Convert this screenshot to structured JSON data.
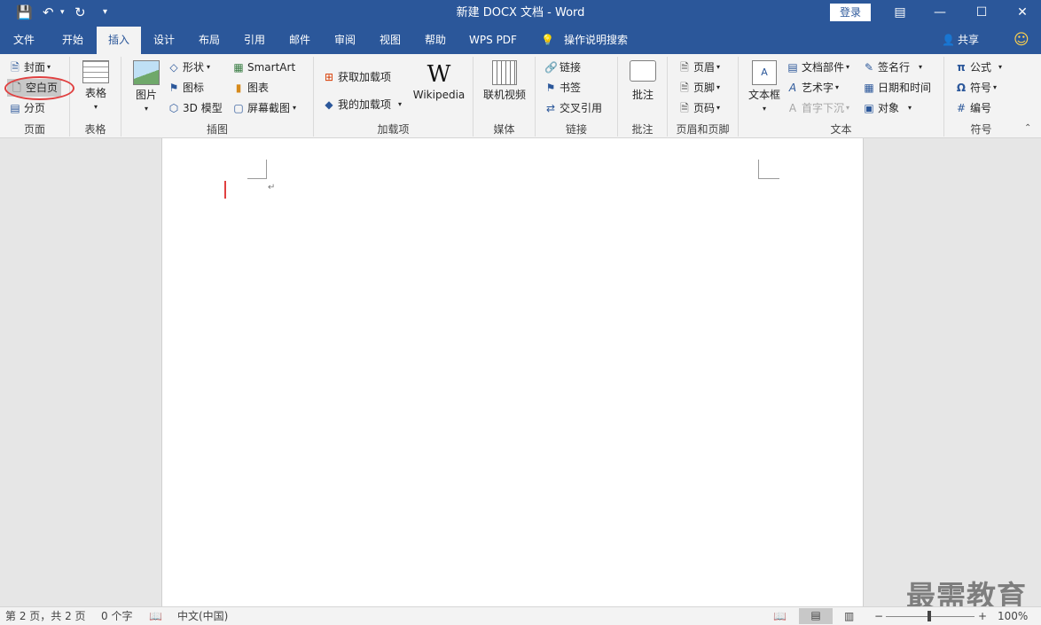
{
  "window": {
    "title": "新建 DOCX 文档 - Word",
    "login_label": "登录"
  },
  "tabs": [
    {
      "label": "文件"
    },
    {
      "label": "开始"
    },
    {
      "label": "插入"
    },
    {
      "label": "设计"
    },
    {
      "label": "布局"
    },
    {
      "label": "引用"
    },
    {
      "label": "邮件"
    },
    {
      "label": "审阅"
    },
    {
      "label": "视图"
    },
    {
      "label": "帮助"
    },
    {
      "label": "WPS PDF"
    }
  ],
  "tell_me": "操作说明搜索",
  "share_label": "共享",
  "groups": {
    "pages": {
      "label": "页面",
      "cover": "封面",
      "blank": "空白页",
      "break": "分页"
    },
    "tables": {
      "label": "表格",
      "table": "表格"
    },
    "illustrations": {
      "label": "插图",
      "pictures": "图片",
      "shapes": "形状",
      "icons": "图标",
      "model3d": "3D 模型",
      "smartart": "SmartArt",
      "chart": "图表",
      "screenshot": "屏幕截图"
    },
    "addins": {
      "label": "加载项",
      "get": "获取加载项",
      "my": "我的加载项",
      "wiki": "Wikipedia"
    },
    "media": {
      "label": "媒体",
      "video": "联机视频"
    },
    "links": {
      "label": "链接",
      "link": "链接",
      "bookmark": "书签",
      "crossref": "交叉引用"
    },
    "comments": {
      "label": "批注",
      "comment": "批注"
    },
    "headerfooter": {
      "label": "页眉和页脚",
      "header": "页眉",
      "footer": "页脚",
      "pagenum": "页码"
    },
    "text": {
      "label": "文本",
      "textbox": "文本框",
      "quickparts": "文档部件",
      "wordart": "艺术字",
      "dropcap": "首字下沉",
      "signature": "签名行",
      "datetime": "日期和时间",
      "object": "对象"
    },
    "symbols": {
      "label": "符号",
      "equation": "公式",
      "symbol": "符号",
      "number": "编号"
    }
  },
  "status": {
    "page": "第 2 页，共 2 页",
    "words": "0 个字",
    "language": "中文(中国)",
    "zoom": "100%"
  },
  "watermark": "最需教育",
  "colors": {
    "brand": "#2b579a",
    "highlight": "#e04040"
  }
}
